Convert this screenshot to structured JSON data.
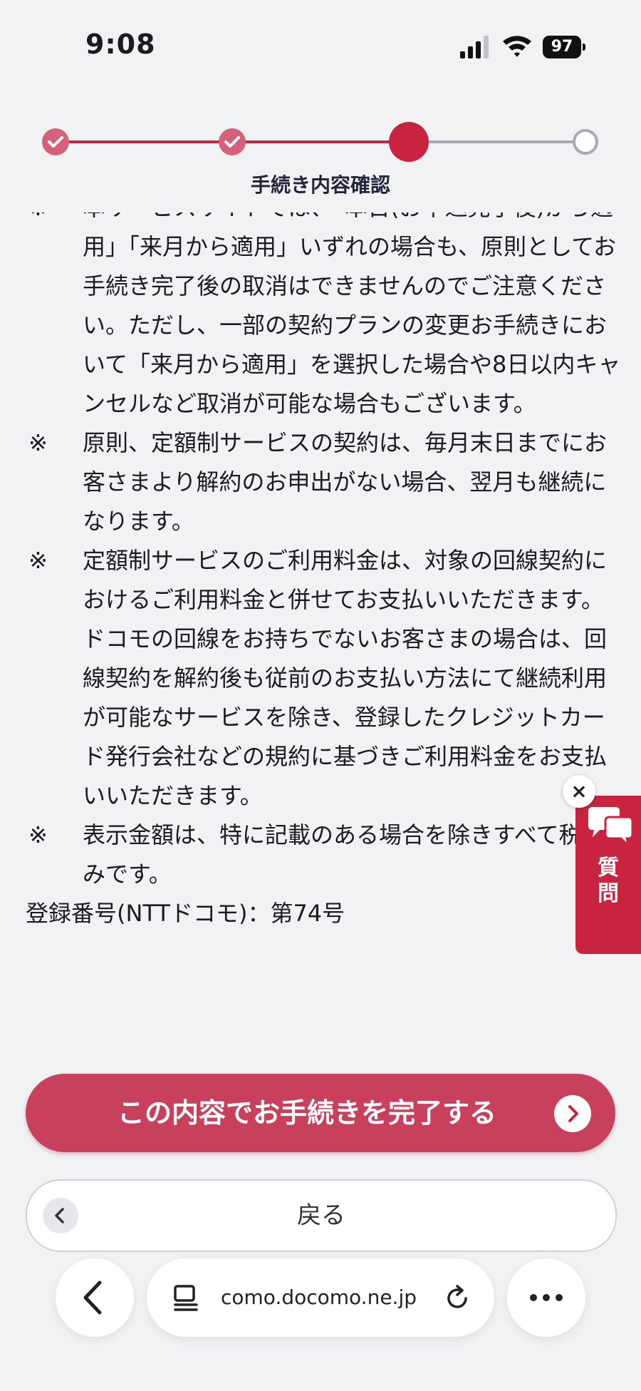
{
  "status_bar": {
    "time": "9:08",
    "battery": "97"
  },
  "stepper": {
    "current_step_label": "手続き内容確認"
  },
  "notes": [
    {
      "mark": "※",
      "text": "本サービスサイトでは、「本日(お申込完了後)から適用」「来月から適用」いずれの場合も、原則としてお手続き完了後の取消はできませんのでご注意ください。ただし、一部の契約プランの変更お手続きにおいて「来月から適用」を選択した場合や8日以内キャンセルなど取消が可能な場合もございます。"
    },
    {
      "mark": "※",
      "text": "原則、定額制サービスの契約は、毎月末日までにお客さまより解約のお申出がない場合、翌月も継続になります。"
    },
    {
      "mark": "※",
      "text": "定額制サービスのご利用料金は、対象の回線契約におけるご利用料金と併せてお支払いいただきます。ドコモの回線をお持ちでないお客さまの場合は、回線契約を解約後も従前のお支払い方法にて継続利用が可能なサービスを除き、登録したクレジットカード発行会社などの規約に基づきご利用料金をお支払いいただきます。"
    },
    {
      "mark": "※",
      "text": "表示金額は、特に記載のある場合を除きすべて税込みです。"
    }
  ],
  "registration": "登録番号(NTTドコモ)：第74号",
  "question_tab": {
    "label_line1": "質",
    "label_line2": "問",
    "close": "×"
  },
  "buttons": {
    "complete": "この内容でお手続きを完了する",
    "back": "戻る"
  },
  "browser": {
    "url": "como.docomo.ne.jp"
  },
  "colors": {
    "accent": "#c8233f",
    "primary_button": "#c9405c",
    "background": "#f1f2f4"
  }
}
